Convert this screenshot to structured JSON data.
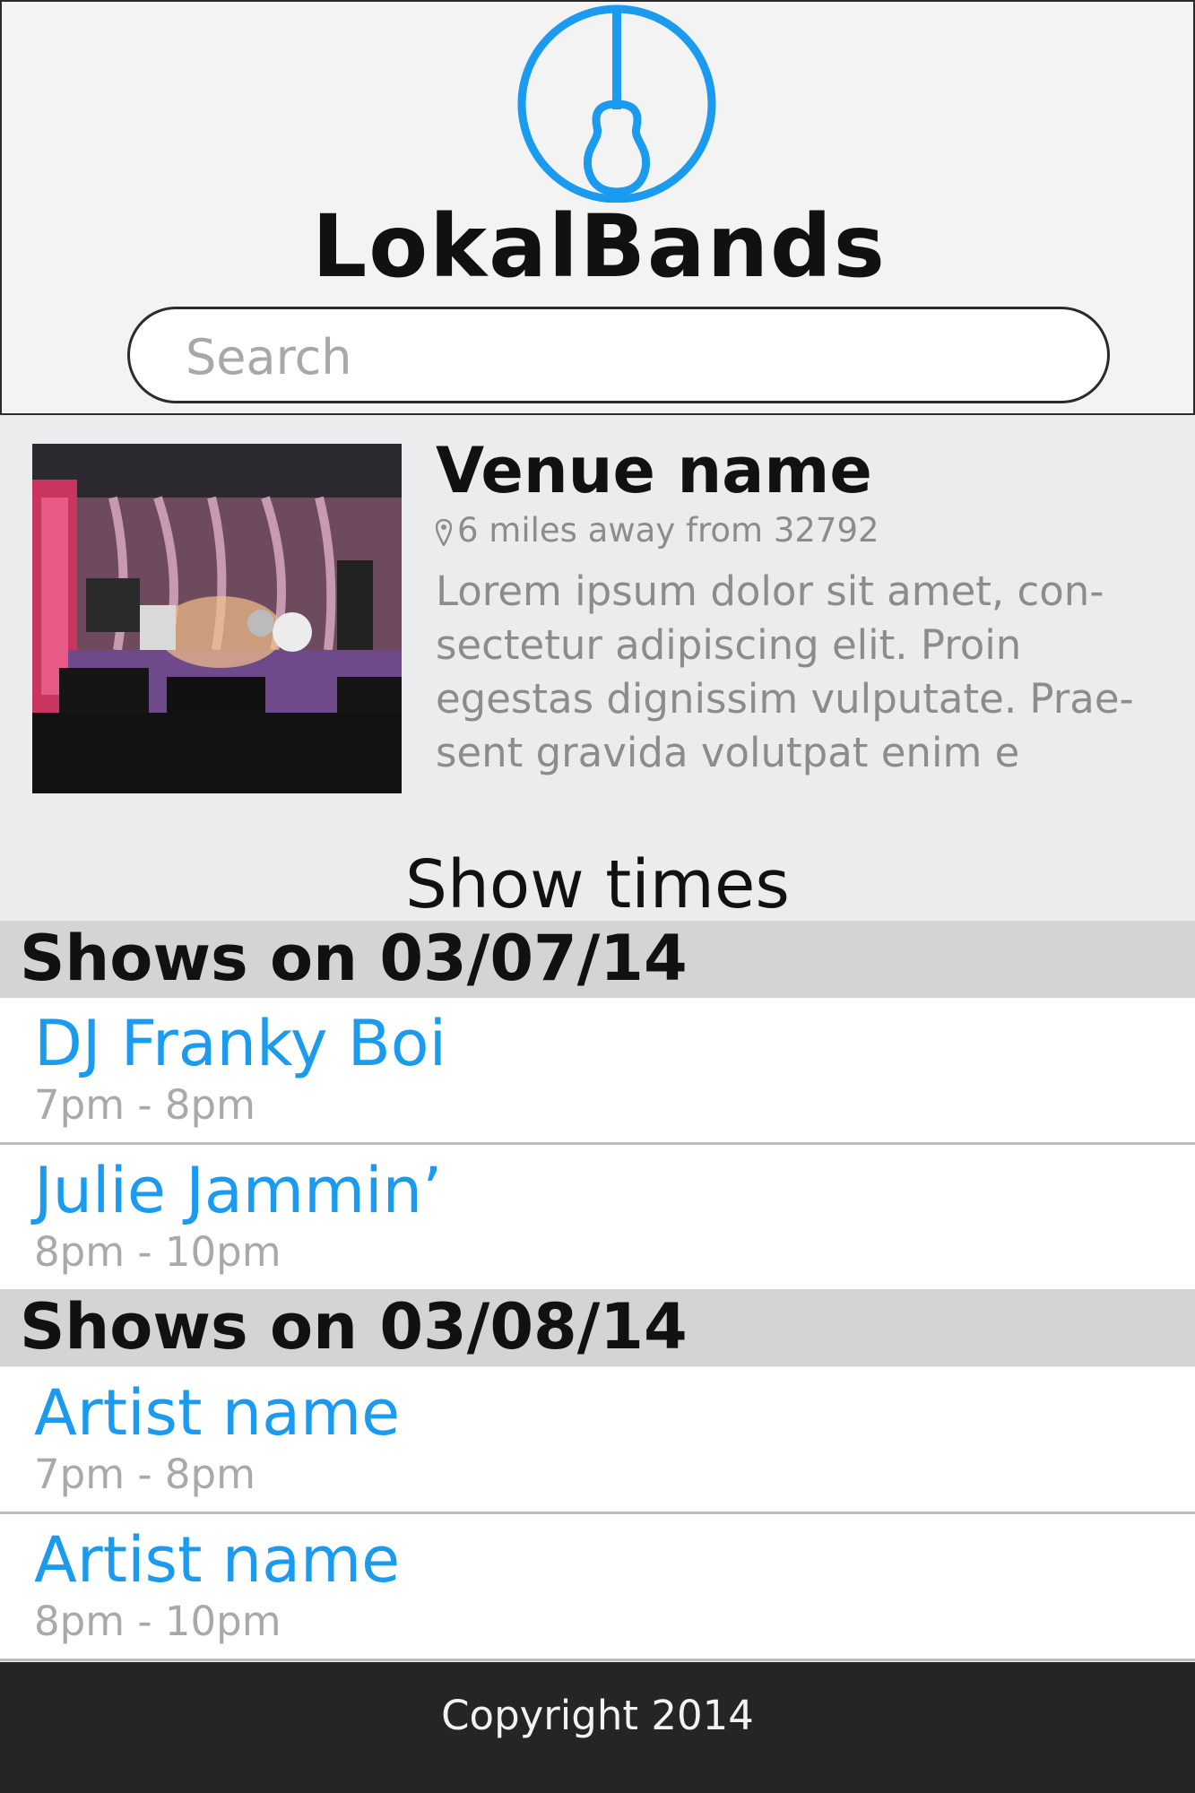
{
  "app": {
    "name": "LokalBands"
  },
  "search": {
    "placeholder": "Search"
  },
  "venue": {
    "name": "Venue name",
    "distance": "6 miles away from 32792",
    "description": "Lorem ipsum dolor sit amet, con-sectetur adipiscing elit. Proin egestas dignissim vulputate. Prae-sent gravida volutpat enim e"
  },
  "show_times": {
    "title": "Show times",
    "days": [
      {
        "header": "Shows on 03/07/14",
        "shows": [
          {
            "artist": "DJ Franky Boi",
            "time": "7pm - 8pm"
          },
          {
            "artist": "Julie Jammin’",
            "time": "8pm - 10pm"
          }
        ]
      },
      {
        "header": "Shows on 03/08/14",
        "shows": [
          {
            "artist": "Artist name",
            "time": "7pm - 8pm"
          },
          {
            "artist": "Artist name",
            "time": "8pm - 10pm"
          }
        ]
      }
    ]
  },
  "footer": {
    "copyright": "Copyright 2014"
  },
  "colors": {
    "accent": "#1a9bf0",
    "footer_bg": "#252525",
    "day_header_bg": "#d3d4d6"
  },
  "icons": {
    "logo": "guitar-logo-icon",
    "location": "map-pin-icon"
  }
}
